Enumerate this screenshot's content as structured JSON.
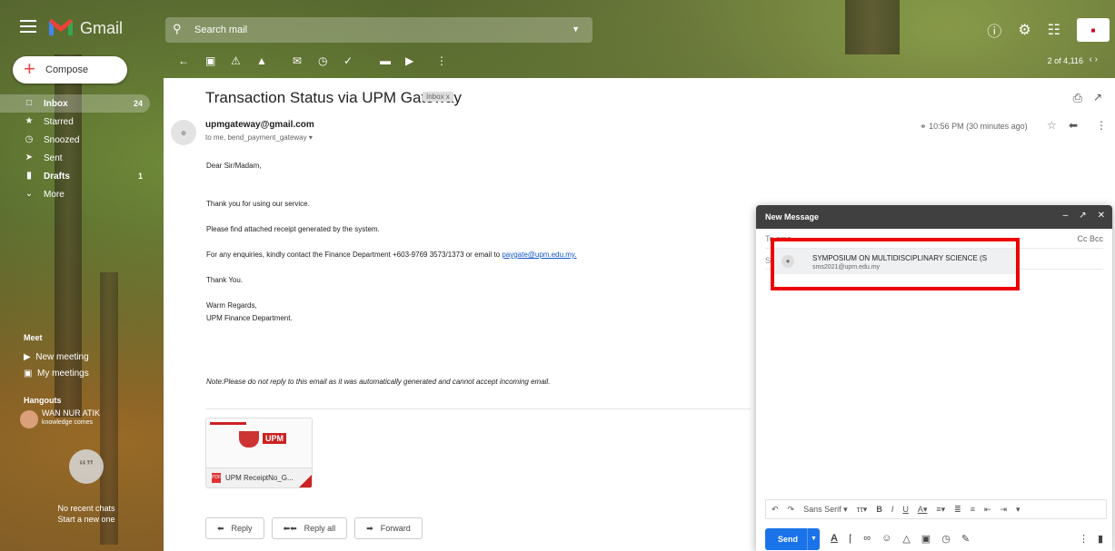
{
  "app": {
    "name": "Gmail"
  },
  "search": {
    "placeholder": "Search mail"
  },
  "pager": {
    "text": "2 of 4,116"
  },
  "sidebar": {
    "compose_label": "Compose",
    "items": [
      {
        "label": "Inbox",
        "count": "24",
        "icon": "inbox-icon"
      },
      {
        "label": "Starred",
        "count": "",
        "icon": "star-icon"
      },
      {
        "label": "Snoozed",
        "count": "",
        "icon": "clock-icon"
      },
      {
        "label": "Sent",
        "count": "",
        "icon": "send-icon"
      },
      {
        "label": "Drafts",
        "count": "1",
        "icon": "draft-icon"
      },
      {
        "label": "More",
        "count": "",
        "icon": "chevron-down-icon"
      }
    ],
    "meet": {
      "heading": "Meet",
      "new_meeting": "New meeting",
      "my_meetings": "My meetings"
    },
    "hangouts": {
      "heading": "Hangouts",
      "user_name": "WAN NUR ATIK",
      "user_status": "knowledge comes",
      "no_chats": "No recent chats",
      "start_new": "Start a new one"
    }
  },
  "email": {
    "subject": "Transaction Status via UPM Gateway",
    "label_chip": "Inbox x",
    "sender": "upmgateway@gmail.com",
    "to_line": "to me, bend_payment_gateway",
    "timestamp": "10:56 PM (30 minutes ago)",
    "body": {
      "greeting": "Dear Sir/Madam,",
      "line1": "Thank you for using our service.",
      "line2": "Please find attached receipt generated by the system.",
      "line3_prefix": "For any enquiries, kindly contact the Finance Department +603-9769 3573/1373 or email to ",
      "line3_link": "paygate@upm.edu.my.",
      "thanks": "Thank You.",
      "regards1": "Warm Regards,",
      "regards2": "UPM Finance Department.",
      "note": "Note:Please do not reply to this email as it was automatically generated and cannot accept incoming email."
    },
    "attachment": {
      "name": "UPM ReceiptNo_G...",
      "logo_text": "UPM"
    },
    "actions": {
      "reply": "Reply",
      "reply_all": "Reply all",
      "forward": "Forward"
    }
  },
  "compose_window": {
    "title": "New Message",
    "to_label": "To",
    "to_value": "sms",
    "cc_bcc": "Cc Bcc",
    "subject_label": "Sub",
    "suggestion": {
      "name": "SYMPOSIUM ON MULTIDISCIPLINARY SCIENCE (S",
      "email": "sms2021@upm.edu.my"
    },
    "font_name": "Sans Serif",
    "send_label": "Send"
  }
}
